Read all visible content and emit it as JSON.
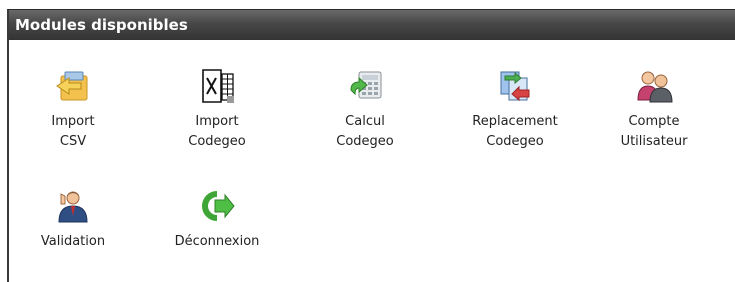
{
  "panel": {
    "title": "Modules disponibles"
  },
  "modules": [
    {
      "label": "Import\nCSV",
      "icon": "folder-import-icon"
    },
    {
      "label": "Import\nCodegeo",
      "icon": "excel-icon"
    },
    {
      "label": "Calcul\nCodegeo",
      "icon": "calculator-icon"
    },
    {
      "label": "Replacement\nCodegeo",
      "icon": "replace-icon"
    },
    {
      "label": "Compte\nUtilisateur",
      "icon": "users-icon"
    },
    {
      "label": "Validation",
      "icon": "validation-user-icon"
    },
    {
      "label": "Déconnexion",
      "icon": "logout-arrow-icon"
    }
  ],
  "colors": {
    "header_bg": "#474747",
    "header_text": "#ffffff",
    "accent_green": "#3fa536",
    "accent_red": "#c83a3a"
  }
}
